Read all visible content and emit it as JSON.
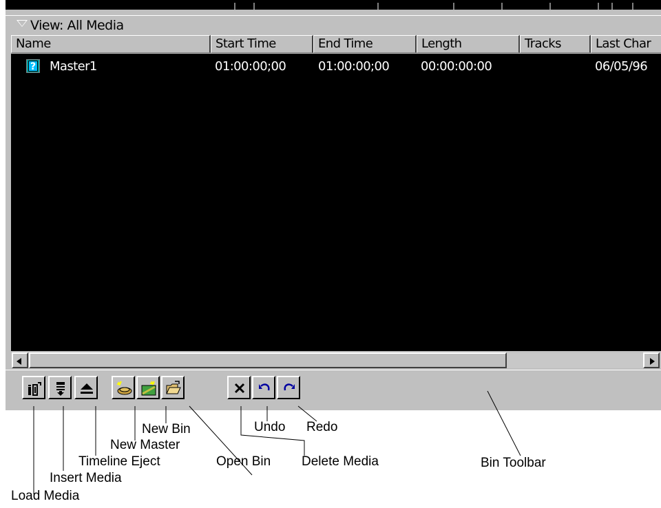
{
  "bin": {
    "view_label": "View:  All Media",
    "columns": [
      "Name",
      "Start Time",
      "End Time",
      "Length",
      "Tracks",
      "Last Char"
    ],
    "items": [
      {
        "name": "Master1",
        "start_time": "01:00:00;00",
        "end_time": "01:00:00;00",
        "length": "00:00:00:00",
        "tracks": "",
        "last_changed": "06/05/96",
        "icon": "master-clip-icon"
      }
    ]
  },
  "toolbar": {
    "buttons": [
      {
        "id": "load-media",
        "icon": "load-media-icon"
      },
      {
        "id": "insert-media",
        "icon": "insert-media-icon"
      },
      {
        "id": "timeline-eject",
        "icon": "eject-icon"
      },
      {
        "id": "new-master",
        "icon": "new-master-icon"
      },
      {
        "id": "new-bin",
        "icon": "new-bin-icon"
      },
      {
        "id": "open-bin",
        "icon": "open-folder-icon"
      },
      {
        "id": "delete-media",
        "icon": "delete-x-icon"
      },
      {
        "id": "undo",
        "icon": "undo-arrow-icon"
      },
      {
        "id": "redo",
        "icon": "redo-arrow-icon"
      }
    ]
  },
  "callouts": {
    "new_bin": "New Bin",
    "new_master": "New Master",
    "timeline_eject": "Timeline Eject",
    "insert_media": "Insert Media",
    "load_media": "Load Media",
    "open_bin": "Open Bin",
    "undo": "Undo",
    "redo": "Redo",
    "delete_media": "Delete Media",
    "bin_toolbar": "Bin Toolbar"
  },
  "colors": {
    "list_background": "#000000",
    "panel_gray": "#c0c0c0",
    "icon_blue": "#0000a0"
  }
}
